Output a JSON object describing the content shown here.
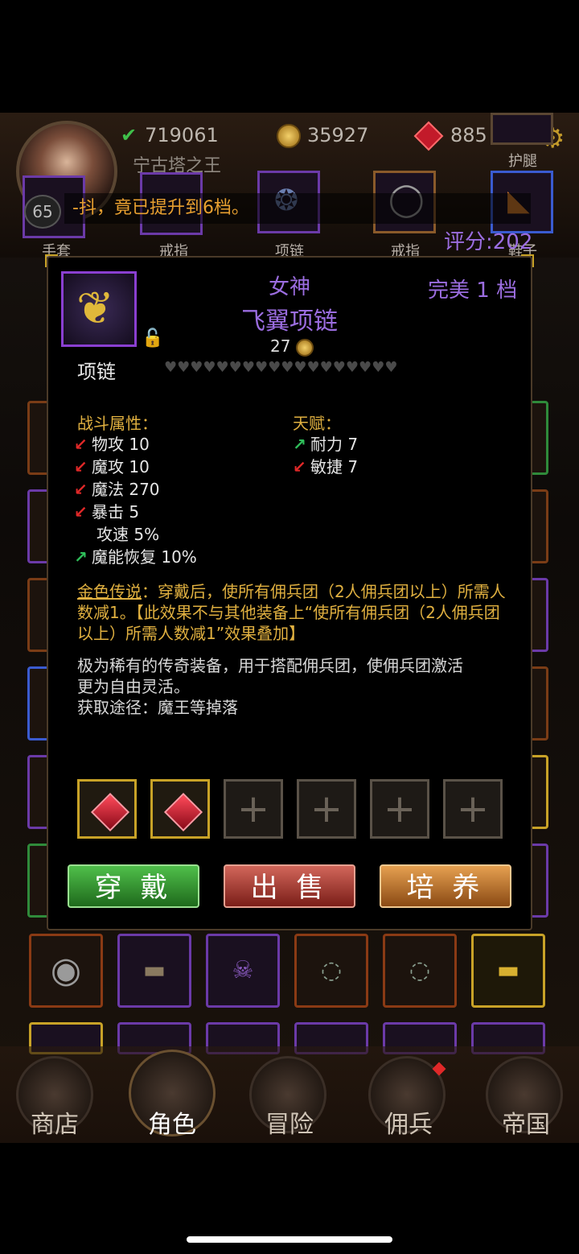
{
  "header": {
    "power": "719061",
    "gold": "35927",
    "gems": "885",
    "player_name": "宁古塔之王",
    "level": "65",
    "ticker": "-抖，竟已提升到6档。",
    "score": "评分:202"
  },
  "equip_slots": [
    {
      "label": "手套",
      "icon": "gloves-icon"
    },
    {
      "label": "戒指",
      "icon": "ring-icon"
    },
    {
      "label": "项链",
      "icon": "necklace-icon"
    },
    {
      "label": "戒指",
      "icon": "ring-icon"
    },
    {
      "label": "鞋子",
      "icon": "boots-icon"
    },
    {
      "label": "护腿",
      "icon": "leggings-icon"
    }
  ],
  "item": {
    "prefix": "女神",
    "name": "飞翼项链",
    "quality": "完美 1 档",
    "price": "27",
    "type": "项链",
    "hearts": "♥♥♥♥♥♥♥♥♥♥♥♥♥♥♥♥♥♥",
    "combat_title": "战斗属性：",
    "combat_stats": [
      {
        "arrow": "down",
        "text": "物攻 10"
      },
      {
        "arrow": "down",
        "text": "魔攻 10"
      },
      {
        "arrow": "down",
        "text": "魔法 270"
      },
      {
        "arrow": "down",
        "text": "暴击 5"
      },
      {
        "arrow": "none",
        "text": "攻速 5%"
      },
      {
        "arrow": "up",
        "text": "魔能恢复 10%"
      }
    ],
    "talent_title": "天赋：",
    "talents": [
      {
        "arrow": "up",
        "text": "耐力 7"
      },
      {
        "arrow": "down",
        "text": "敏捷 7"
      }
    ],
    "legend_label": "金色传说",
    "legend_text": "：穿戴后，使所有佣兵团（2人佣兵团以上）所需人数减1。【此效果不与其他装备上“使所有佣兵团（2人佣兵团以上）所需人数减1”效果叠加】",
    "desc_line1": "极为稀有的传奇装备，用于搭配佣兵团，使佣兵团激活",
    "desc_line2": "更为自由灵活。",
    "desc_line3": "获取途径：魔王等掉落"
  },
  "buttons": {
    "wear": "穿 戴",
    "sell": "出 售",
    "train": "培 养"
  },
  "nav": [
    {
      "label": "商店"
    },
    {
      "label": "角色"
    },
    {
      "label": "冒险"
    },
    {
      "label": "佣兵"
    },
    {
      "label": "帝国"
    }
  ],
  "colors": {
    "accent_purple": "#9b6de0",
    "gold_text": "#e0b040",
    "stat_down": "#e02828",
    "stat_up": "#2fbf5a"
  }
}
